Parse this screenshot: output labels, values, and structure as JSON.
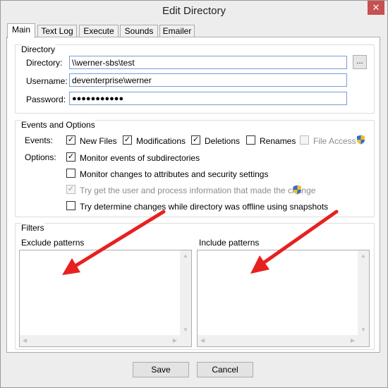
{
  "window": {
    "title": "Edit Directory",
    "close_symbol": "✕"
  },
  "tabs": [
    "Main",
    "Text Log",
    "Execute",
    "Sounds",
    "Emailer"
  ],
  "directory_group": {
    "title": "Directory",
    "directory_label": "Directory:",
    "directory_value": "\\\\werner-sbs\\test",
    "browse_label": "...",
    "username_label": "Username:",
    "username_value": "deventerprise\\werner",
    "password_label": "Password:",
    "password_value": "●●●●●●●●●●●"
  },
  "events_group": {
    "title": "Events and Options",
    "events_label": "Events:",
    "options_label": "Options:",
    "events": [
      {
        "label": "New Files",
        "checked": true
      },
      {
        "label": "Modifications",
        "checked": true
      },
      {
        "label": "Deletions",
        "checked": true
      },
      {
        "label": "Renames",
        "checked": false
      },
      {
        "label": "File Access",
        "checked": false,
        "disabled": true
      }
    ],
    "options": [
      {
        "label": "Monitor events of subdirectories",
        "checked": true
      },
      {
        "label": "Monitor changes to attributes and security settings",
        "checked": false
      },
      {
        "label": "Try get the user and process information that made the change",
        "checked": true,
        "disabled": true
      },
      {
        "label": "Try determine changes while directory was offline using snapshots",
        "checked": false
      }
    ]
  },
  "filters_group": {
    "title": "Filters",
    "exclude_label": "Exclude patterns",
    "include_label": "Include patterns"
  },
  "buttons": {
    "save": "Save",
    "cancel": "Cancel"
  },
  "colors": {
    "annotation_arrow": "#e82020",
    "shield_blue": "#2e6fd1",
    "shield_yellow": "#f2c020"
  },
  "icons": [
    "close-icon",
    "shield-icon",
    "checkmark-icon",
    "scroll-up-arrow",
    "scroll-down-arrow",
    "scroll-left-arrow",
    "scroll-right-arrow",
    "annotation-arrow"
  ]
}
